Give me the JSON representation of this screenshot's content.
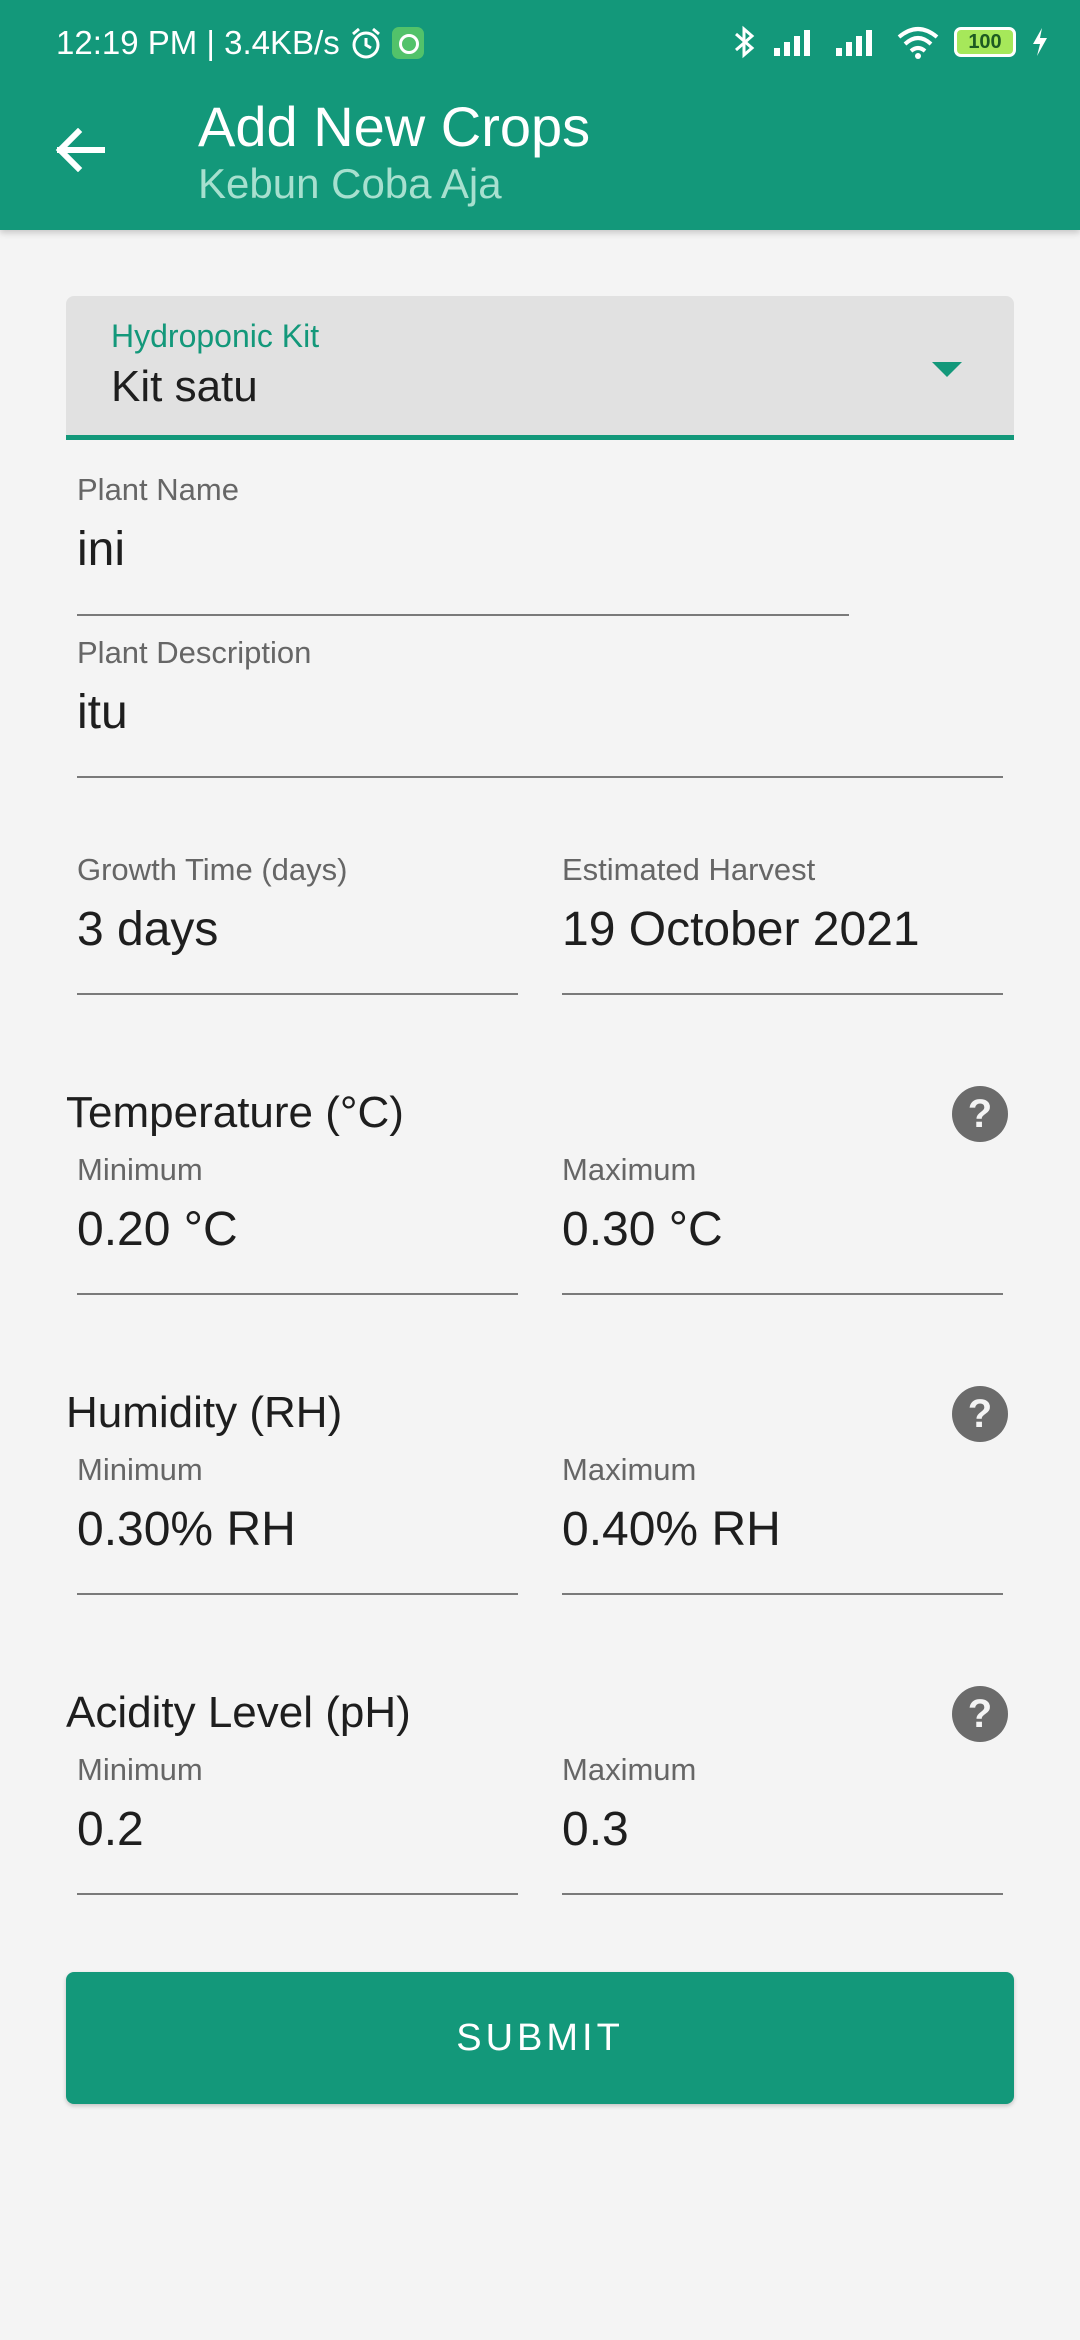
{
  "status_bar": {
    "left_text": "12:19 PM | 3.4KB/s",
    "battery": "100"
  },
  "header": {
    "title": "Add New Crops",
    "subtitle": "Kebun Coba Aja"
  },
  "kit": {
    "label": "Hydroponic Kit",
    "value": "Kit satu"
  },
  "plant_name": {
    "label": "Plant Name",
    "value": "ini"
  },
  "plant_description": {
    "label": "Plant Description",
    "value": "itu"
  },
  "growth_time": {
    "label": "Growth Time (days)",
    "value": "3 days"
  },
  "estimated_harvest": {
    "label": "Estimated Harvest",
    "value": "19 October 2021"
  },
  "temperature": {
    "title": "Temperature (°C)",
    "min_label": "Minimum",
    "min_value": "0.20 °C",
    "max_label": "Maximum",
    "max_value": "0.30 °C"
  },
  "humidity": {
    "title": "Humidity (RH)",
    "min_label": "Minimum",
    "min_value": "0.30% RH",
    "max_label": "Maximum",
    "max_value": "0.40% RH"
  },
  "acidity": {
    "title": "Acidity Level (pH)",
    "min_label": "Minimum",
    "min_value": "0.2",
    "max_label": "Maximum",
    "max_value": "0.3"
  },
  "help_glyph": "?",
  "submit_label": "SUBMIT",
  "colors": {
    "primary": "#13987a",
    "background": "#f4f4f4"
  }
}
